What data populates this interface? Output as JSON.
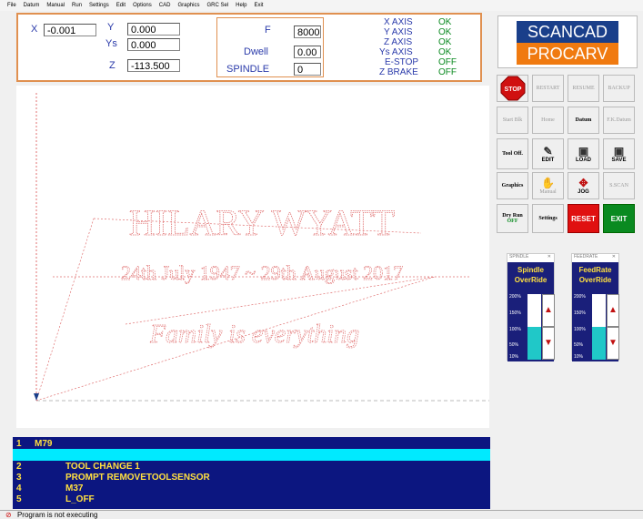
{
  "menu": [
    "File",
    "Datum",
    "Manual",
    "Run",
    "Settings",
    "Edit",
    "Options",
    "CAD",
    "Graphics",
    "GRC Sel",
    "Help",
    "Exit"
  ],
  "coords": {
    "x_label": "X",
    "x_value": "-0.001",
    "y_label": "Y",
    "y_value": "0.000",
    "ys_label": "Ys",
    "ys_value": "0.000",
    "z_label": "Z",
    "z_value": "-113.500"
  },
  "params": {
    "f_label": "F",
    "f_value": "8000",
    "dwell_label": "Dwell",
    "dwell_value": "0.00",
    "spindle_label": "SPINDLE",
    "spindle_value": "0"
  },
  "axis_status": [
    {
      "label": "X AXIS",
      "state": "OK"
    },
    {
      "label": "Y AXIS",
      "state": "OK"
    },
    {
      "label": "Z AXIS",
      "state": "OK"
    },
    {
      "label": "Ys AXIS",
      "state": "OK"
    },
    {
      "label": "E-STOP",
      "state": "OFF"
    },
    {
      "label": "Z BRAKE",
      "state": "OFF"
    }
  ],
  "logo": {
    "line1": "SCANCAD",
    "line2": "PROCARV"
  },
  "toolbar": {
    "stop": "STOP",
    "restart": "RESTART",
    "resume": "RESUME",
    "backup": "BACKUP",
    "start_blk": "Start Blk",
    "home": "Home",
    "datum": "Datum",
    "fk_datum": "F.K.Datum",
    "tool_off": "Tool Off.",
    "edit": "EDIT",
    "load": "LOAD",
    "save": "SAVE",
    "graphics": "Graphics",
    "manual": "Manual",
    "jog": "JOG",
    "sscan": "S.SCAN",
    "dry_run": "Dry Run",
    "dry_run_state": "OFF",
    "settings": "Settings",
    "reset": "RESET",
    "exit": "EXIT"
  },
  "spindle_override": {
    "window_title": "SPINDLE",
    "heading_1": "Spindle",
    "heading_2": "OverRide",
    "scale": [
      "200%",
      "150%",
      "100%",
      "50%",
      "10%"
    ],
    "level_percent": 100
  },
  "feed_override": {
    "window_title": "FEEDRATE",
    "heading_1": "FeedRate",
    "heading_2": "OverRide",
    "scale": [
      "200%",
      "150%",
      "100%",
      "50%",
      "10%"
    ],
    "level_percent": 100
  },
  "engraving": {
    "line1": "HILARY WYATT",
    "line2": "24th July 1947 ~ 29th August 2017",
    "line3": "Family is everything"
  },
  "code_lines": [
    {
      "num": "1",
      "text": "M79"
    },
    {
      "num": "2",
      "text": "TOOL CHANGE 1"
    },
    {
      "num": "3",
      "text": "PROMPT REMOVETOOLSENSOR"
    },
    {
      "num": "4",
      "text": "M37"
    },
    {
      "num": "5",
      "text": "L_OFF"
    }
  ],
  "status_text": "Program is not executing",
  "colors": {
    "panel_border": "#e09050",
    "ok_green": "#0a8a20",
    "label_blue": "#2a3aaa",
    "code_bg": "#0c1680",
    "code_text": "#ffe040",
    "highlight": "#00eaff",
    "engrave_red": "#e07070"
  }
}
